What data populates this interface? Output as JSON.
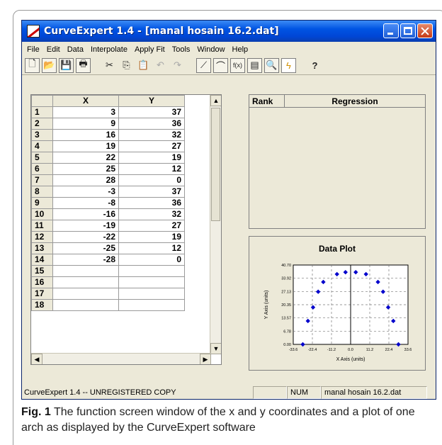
{
  "window": {
    "title": "CurveExpert 1.4 - [manal hosain 16.2.dat]"
  },
  "menu": [
    "File",
    "Edit",
    "Data",
    "Interpolate",
    "Apply Fit",
    "Tools",
    "Window",
    "Help"
  ],
  "toolbar": {
    "icons": [
      "new-file-icon",
      "open-folder-icon",
      "save-icon",
      "print-icon",
      "cut-icon",
      "copy-icon",
      "paste-icon",
      "undo-icon",
      "redo-icon",
      "curve-fit-icon",
      "graph-icon",
      "function-icon",
      "rank-icon",
      "plot-zoom-icon",
      "lightning-icon",
      "help-icon"
    ]
  },
  "grid": {
    "columns": [
      "X",
      "Y"
    ],
    "rows": [
      {
        "n": "1",
        "x": "3",
        "y": "37"
      },
      {
        "n": "2",
        "x": "9",
        "y": "36"
      },
      {
        "n": "3",
        "x": "16",
        "y": "32"
      },
      {
        "n": "4",
        "x": "19",
        "y": "27"
      },
      {
        "n": "5",
        "x": "22",
        "y": "19"
      },
      {
        "n": "6",
        "x": "25",
        "y": "12"
      },
      {
        "n": "7",
        "x": "28",
        "y": "0"
      },
      {
        "n": "8",
        "x": "-3",
        "y": "37"
      },
      {
        "n": "9",
        "x": "-8",
        "y": "36"
      },
      {
        "n": "10",
        "x": "-16",
        "y": "32"
      },
      {
        "n": "11",
        "x": "-19",
        "y": "27"
      },
      {
        "n": "12",
        "x": "-22",
        "y": "19"
      },
      {
        "n": "13",
        "x": "-25",
        "y": "12"
      },
      {
        "n": "14",
        "x": "-28",
        "y": "0"
      },
      {
        "n": "15",
        "x": "",
        "y": ""
      },
      {
        "n": "16",
        "x": "",
        "y": ""
      },
      {
        "n": "17",
        "x": "",
        "y": ""
      },
      {
        "n": "18",
        "x": "",
        "y": ""
      }
    ]
  },
  "regression": {
    "rank_label": "Rank",
    "regression_label": "Regression"
  },
  "chart_data": {
    "type": "scatter",
    "title": "Data Plot",
    "xlabel": "X Axis (units)",
    "ylabel": "Y Axis (units)",
    "x_ticks": [
      "-33.6",
      "-22.4",
      "-11.2",
      "0.0",
      "11.2",
      "22.4",
      "33.6"
    ],
    "y_ticks": [
      "0.00",
      "6.78",
      "13.57",
      "20.35",
      "27.13",
      "33.92",
      "40.70"
    ],
    "xlim": [
      -33.6,
      33.6
    ],
    "ylim": [
      0,
      40.7
    ],
    "grid": true,
    "point_color": "#0000cc",
    "points": [
      {
        "x": 3,
        "y": 37
      },
      {
        "x": 9,
        "y": 36
      },
      {
        "x": 16,
        "y": 32
      },
      {
        "x": 19,
        "y": 27
      },
      {
        "x": 22,
        "y": 19
      },
      {
        "x": 25,
        "y": 12
      },
      {
        "x": 28,
        "y": 0
      },
      {
        "x": -3,
        "y": 37
      },
      {
        "x": -8,
        "y": 36
      },
      {
        "x": -16,
        "y": 32
      },
      {
        "x": -19,
        "y": 27
      },
      {
        "x": -22,
        "y": 19
      },
      {
        "x": -25,
        "y": 12
      },
      {
        "x": -28,
        "y": 0
      }
    ]
  },
  "status": {
    "main": "CurveExpert 1.4 -- UNREGISTERED COPY",
    "num": "NUM",
    "file": "manal hosain 16.2.dat"
  },
  "caption": {
    "fig_label": "Fig. 1",
    "text": "The function screen window of the x and y coordinates and a plot of one arch as displayed by the CurveExpert software"
  }
}
